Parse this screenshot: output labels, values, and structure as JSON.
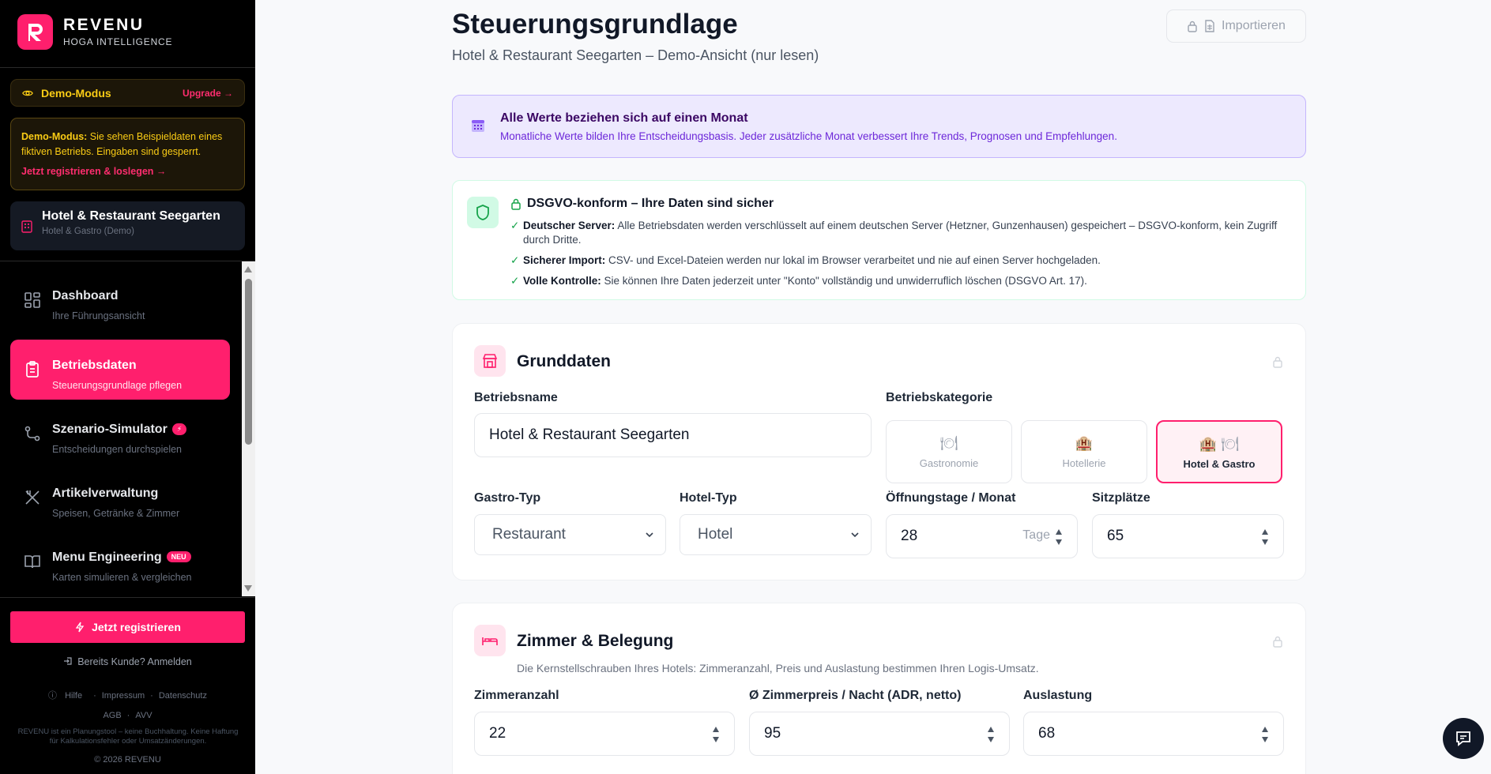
{
  "brand": {
    "name": "REVENU",
    "tagline": "HOGA INTELLIGENCE",
    "accent": "#ff1f6d"
  },
  "demo": {
    "label": "Demo-Modus",
    "upgrade": "Upgrade →",
    "notice_bold": "Demo-Modus:",
    "notice_text": " Sie sehen Beispieldaten eines fiktiven Betriebs. Eingaben sind gesperrt.",
    "register_link": "Jetzt registrieren & loslegen →"
  },
  "business": {
    "name": "Hotel & Restaurant Seegarten",
    "subtitle": "Hotel & Gastro (Demo)"
  },
  "nav": {
    "items": [
      {
        "title": "Dashboard",
        "subtitle": "Ihre Führungsansicht",
        "icon": "dashboard-icon"
      },
      {
        "title": "Betriebsdaten",
        "subtitle": "Steuerungsgrundlage pflegen",
        "icon": "clipboard-icon",
        "active": true
      },
      {
        "title": "Szenario-Simulator",
        "subtitle": "Entscheidungen durchspielen",
        "icon": "scenario-icon",
        "badge": "⚡"
      },
      {
        "title": "Artikelverwaltung",
        "subtitle": "Speisen, Getränke & Zimmer",
        "icon": "utensils-icon"
      },
      {
        "title": "Menu Engineering",
        "subtitle": "Karten simulieren & vergleichen",
        "icon": "book-icon",
        "badge": "NEU"
      }
    ]
  },
  "footer": {
    "register": "Jetzt registrieren",
    "login": "Bereits Kunde? Anmelden",
    "help": "Hilfe",
    "impressum": "Impressum",
    "privacy": "Datenschutz",
    "agb": "AGB",
    "avv": "AVV",
    "disclaimer": "REVENU ist ein Planungstool – keine Buchhaltung. Keine Haftung für Kalkulationsfehler oder Umsatzänderungen.",
    "copyright": "© 2026 REVENU"
  },
  "page": {
    "title": "Steuerungsgrundlage",
    "subtitle": "Hotel & Restaurant Seegarten – Demo-Ansicht (nur lesen)",
    "import": "Importieren"
  },
  "month_info": {
    "title": "Alle Werte beziehen sich auf einen Monat",
    "text": "Monatliche Werte bilden Ihre Entscheidungsbasis. Jeder zusätzliche Monat verbessert Ihre Trends, Prognosen und Empfehlungen."
  },
  "gdpr": {
    "title": "DSGVO-konform – Ihre Daten sind sicher",
    "items": [
      {
        "bold": "Deutscher Server:",
        "text": " Alle Betriebsdaten werden verschlüsselt auf einem deutschen Server (Hetzner, Gunzenhausen) gespeichert – DSGVO-konform, kein Zugriff durch Dritte."
      },
      {
        "bold": "Sicherer Import:",
        "text": " CSV- und Excel-Dateien werden nur lokal im Browser verarbeitet und nie auf einen Server hochgeladen."
      },
      {
        "bold": "Volle Kontrolle:",
        "text": " Sie können Ihre Daten jederzeit unter \"Konto\" vollständig und unwiderruflich löschen (DSGVO Art. 17)."
      }
    ]
  },
  "grunddaten": {
    "title": "Grunddaten",
    "name_label": "Betriebsname",
    "name_value": "Hotel & Restaurant Seegarten",
    "category_label": "Betriebskategorie",
    "categories": [
      {
        "label": "Gastronomie",
        "icon": "🍽"
      },
      {
        "label": "Hotellerie",
        "icon": "🏨"
      },
      {
        "label": "Hotel & Gastro",
        "icon": "🏨 🍽",
        "selected": true
      }
    ],
    "gastro_type_label": "Gastro-Typ",
    "gastro_type_value": "Restaurant",
    "hotel_type_label": "Hotel-Typ",
    "hotel_type_value": "Hotel",
    "open_days_label": "Öffnungstage / Monat",
    "open_days_value": "28",
    "open_days_unit": "Tage",
    "seats_label": "Sitzplätze",
    "seats_value": "65"
  },
  "zimmer": {
    "title": "Zimmer & Belegung",
    "subtitle": "Die Kernstellschrauben Ihres Hotels: Zimmeranzahl, Preis und Auslastung bestimmen Ihren Logis-Umsatz.",
    "rooms_label": "Zimmeranzahl",
    "rooms_value": "22",
    "adr_label": "Ø Zimmerpreis / Nacht (ADR, netto)",
    "adr_value": "95",
    "occupancy_label": "Auslastung",
    "occupancy_value": "68"
  }
}
